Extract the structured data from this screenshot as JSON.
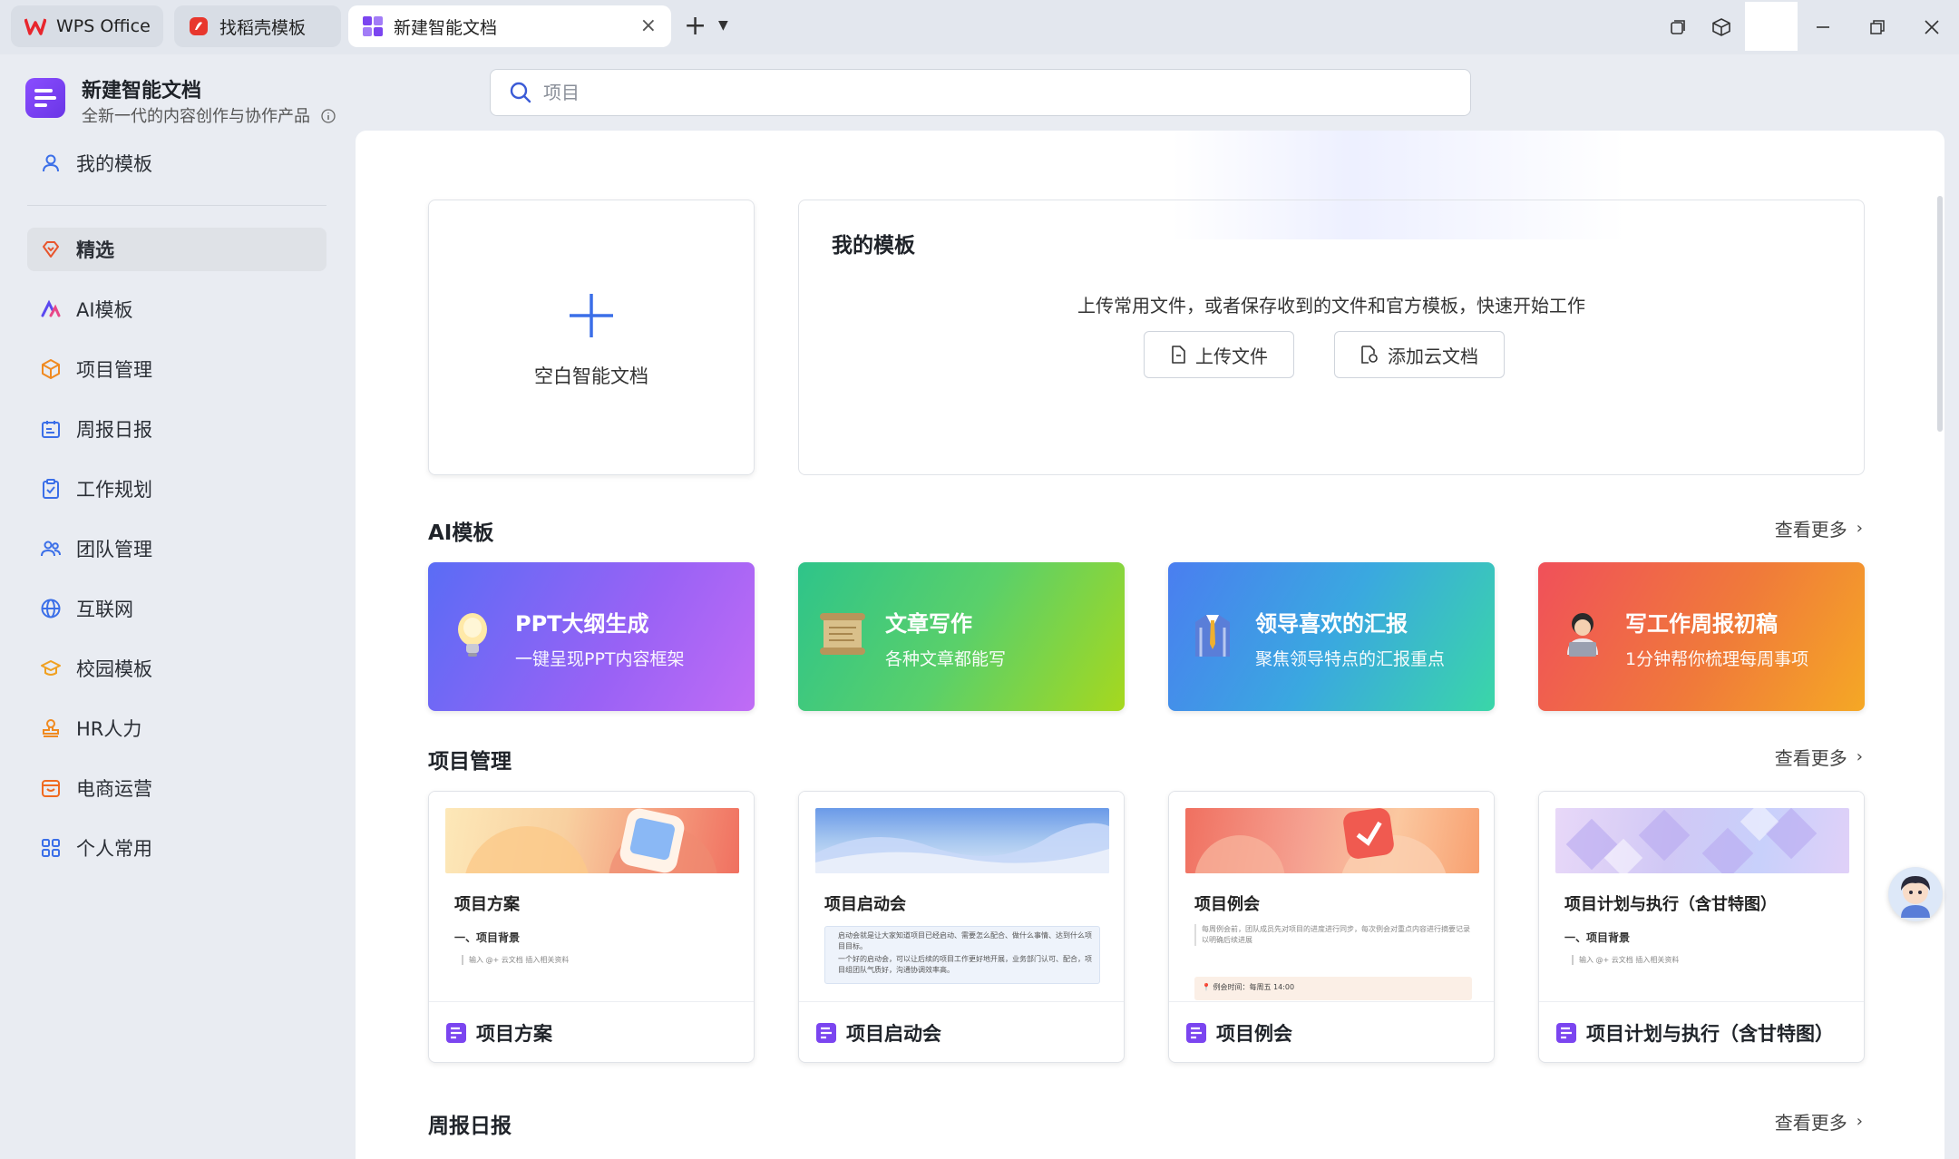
{
  "tabs": [
    {
      "label": "WPS Office"
    },
    {
      "label": "找稻壳模板"
    },
    {
      "label": "新建智能文档"
    }
  ],
  "app": {
    "title": "新建智能文档",
    "subtitle": "全新一代的内容创作与协作产品"
  },
  "sidebar": {
    "items": [
      {
        "label": "我的模板"
      },
      {
        "label": "精选"
      },
      {
        "label": "AI模板"
      },
      {
        "label": "项目管理"
      },
      {
        "label": "周报日报"
      },
      {
        "label": "工作规划"
      },
      {
        "label": "团队管理"
      },
      {
        "label": "互联网"
      },
      {
        "label": "校园模板"
      },
      {
        "label": "HR人力"
      },
      {
        "label": "电商运营"
      },
      {
        "label": "个人常用"
      }
    ]
  },
  "search": {
    "placeholder": "项目"
  },
  "blank_doc": {
    "label": "空白智能文档"
  },
  "my_templates": {
    "title": "我的模板",
    "description": "上传常用文件，或者保存收到的文件和官方模板，快速开始工作",
    "upload_button": "上传文件",
    "add_cloud_button": "添加云文档"
  },
  "ai_section": {
    "title": "AI模板",
    "more": "查看更多",
    "cards": [
      {
        "title": "PPT大纲生成",
        "subtitle": "一键呈现PPT内容框架"
      },
      {
        "title": "文章写作",
        "subtitle": "各种文章都能写"
      },
      {
        "title": "领导喜欢的汇报",
        "subtitle": "聚焦领导特点的汇报重点"
      },
      {
        "title": "写工作周报初稿",
        "subtitle": "1分钟帮你梳理每周事项"
      }
    ]
  },
  "pm_section": {
    "title": "项目管理",
    "more": "查看更多",
    "cards": [
      {
        "doc_title": "项目方案",
        "sub": "一、项目背景",
        "hint": "输入 @+ 云文档 插入相关资料",
        "name": "项目方案"
      },
      {
        "doc_title": "项目启动会",
        "note1": "启动会就是让大家知道项目已经启动、需要怎么配合、做什么事情、达到什么项目目标。",
        "note2": "一个好的启动会，可以让后续的项目工作更好地开展，业务部门认可、配合，项目组团队气质好，沟通协调效率高。",
        "name": "项目启动会"
      },
      {
        "doc_title": "项目例会",
        "desc": "每周例会前，团队成员先对项目的进度进行同步，每次例会对重点内容进行摘要记录以明确后续进展",
        "time": "例会时间：每周五 14:00",
        "name": "项目例会"
      },
      {
        "doc_title": "项目计划与执行（含甘特图）",
        "sub": "一、项目背景",
        "hint": "输入 @+ 云文档 插入相关资料",
        "name": "项目计划与执行（含甘特图）"
      }
    ]
  },
  "weekly_section": {
    "title": "周报日报",
    "more": "查看更多"
  }
}
